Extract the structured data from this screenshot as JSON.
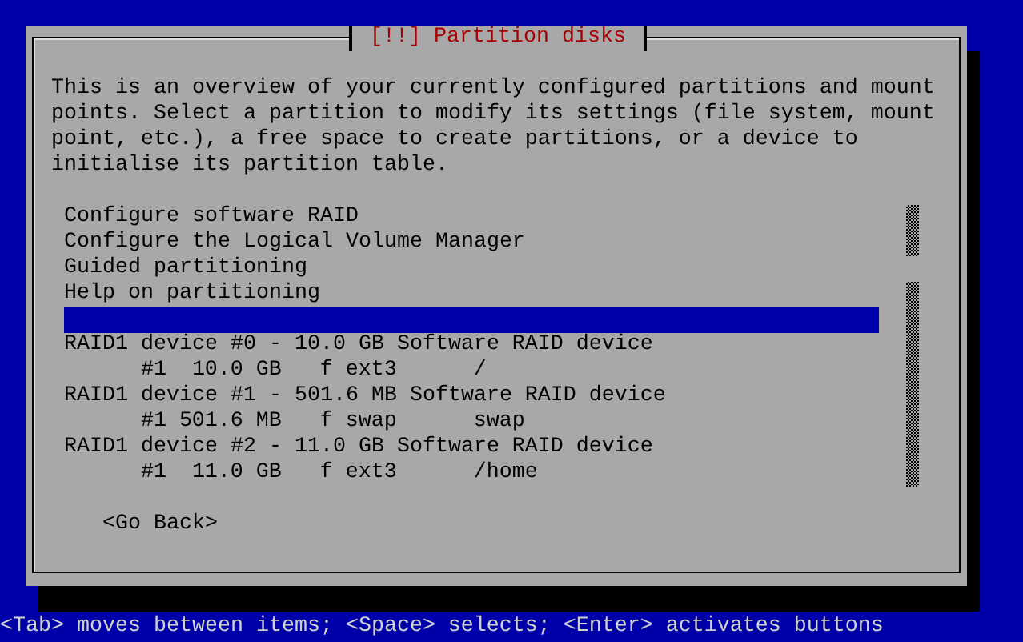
{
  "dialog": {
    "title": "[!!] Partition disks",
    "description": "This is an overview of your currently configured partitions and mount points. Select a partition to modify its settings (file system, mount point, etc.), a free space to create partitions, or a device to initialise its partition table.",
    "items": [
      {
        "kind": "action",
        "label": "Configure software RAID",
        "selected": false
      },
      {
        "kind": "action",
        "label": "Configure the Logical Volume Manager",
        "selected": false
      },
      {
        "kind": "action",
        "label": "Guided partitioning",
        "selected": false
      },
      {
        "kind": "action",
        "label": "Help on partitioning",
        "selected": false
      },
      {
        "kind": "blank",
        "selected": true
      },
      {
        "kind": "device",
        "label": "RAID1 device #0 - 10.0 GB Software RAID device",
        "selected": false
      },
      {
        "kind": "partition",
        "number": "#1",
        "size": "10.0 GB",
        "format": "f",
        "filesystem": "ext3",
        "mount": "/",
        "selected": false
      },
      {
        "kind": "device",
        "label": "RAID1 device #1 - 501.6 MB Software RAID device",
        "selected": false
      },
      {
        "kind": "partition",
        "number": "#1",
        "size": "501.6 MB",
        "format": "f",
        "filesystem": "swap",
        "mount": "swap",
        "selected": false
      },
      {
        "kind": "device",
        "label": "RAID1 device #2 - 11.0 GB Software RAID device",
        "selected": false
      },
      {
        "kind": "partition",
        "number": "#1",
        "size": "11.0 GB",
        "format": "f",
        "filesystem": "ext3",
        "mount": "/home",
        "selected": false
      }
    ],
    "buttons": [
      "<Go Back>"
    ]
  },
  "status_bar": "<Tab> moves between items; <Space> selects; <Enter> activates buttons"
}
